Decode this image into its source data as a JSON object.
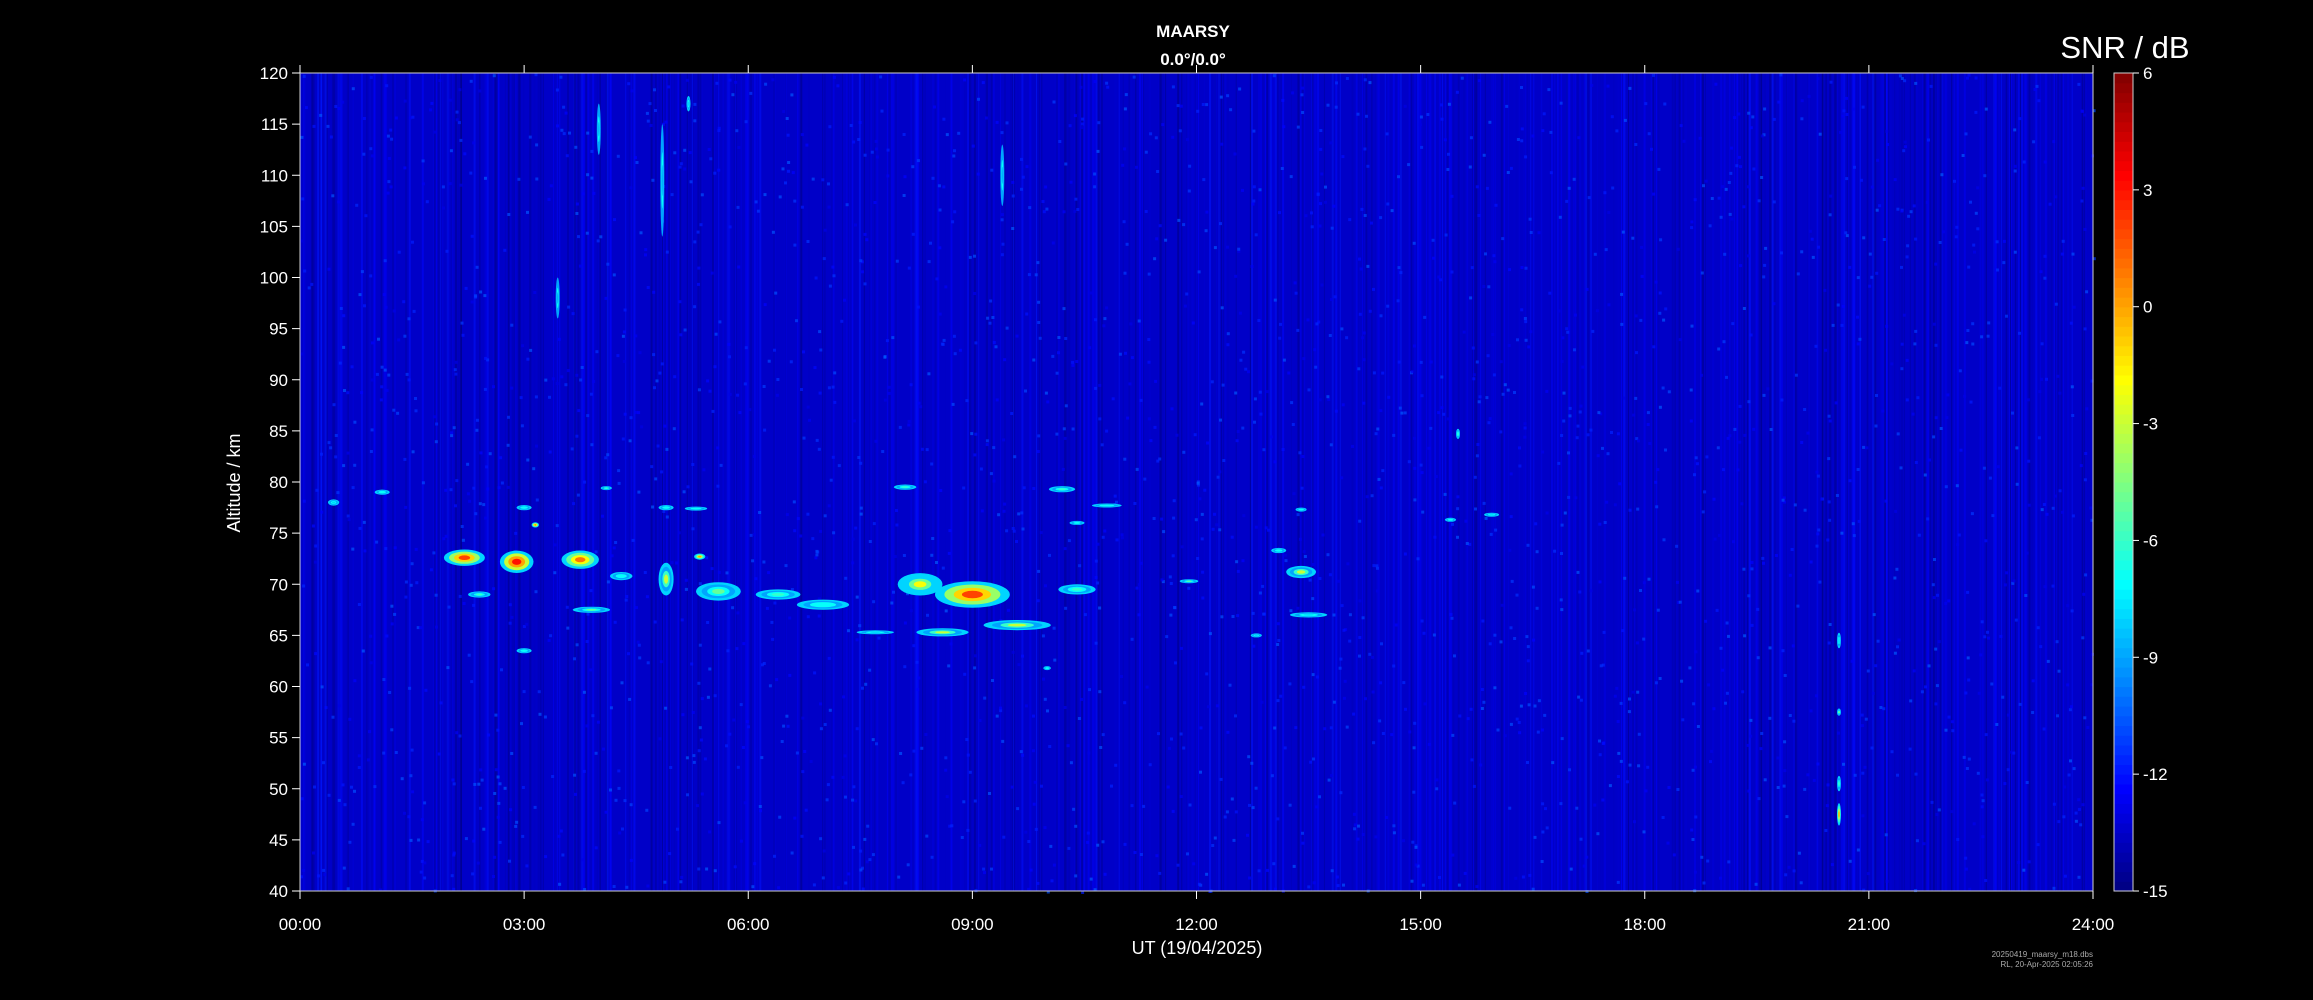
{
  "chart_data": {
    "type": "heatmap",
    "title": "MAARSY",
    "subtitle": "0.0°/0.0°",
    "xlabel": "UT (19/04/2025)",
    "ylabel": "Altitude / km",
    "x_ticks": [
      "00:00",
      "03:00",
      "06:00",
      "09:00",
      "12:00",
      "15:00",
      "18:00",
      "21:00",
      "24:00"
    ],
    "x_tick_hours": [
      0,
      3,
      6,
      9,
      12,
      15,
      18,
      21,
      24
    ],
    "xlim_hours": [
      0,
      24
    ],
    "y_ticks": [
      40,
      45,
      50,
      55,
      60,
      65,
      70,
      75,
      80,
      85,
      90,
      95,
      100,
      105,
      110,
      115,
      120
    ],
    "ylim": [
      40,
      120
    ],
    "colorbar": {
      "label": "SNR / dB",
      "range": [
        -15,
        6
      ],
      "ticks": [
        6,
        3,
        0,
        -3,
        -6,
        -9,
        -12,
        -15
      ],
      "colormap": "jet"
    },
    "background_snr": -13.5,
    "echoes": [
      {
        "t": 0.45,
        "h": 78,
        "dt": 0.15,
        "dh": 0.6,
        "snr": -8
      },
      {
        "t": 1.1,
        "h": 79,
        "dt": 0.2,
        "dh": 0.5,
        "snr": -7
      },
      {
        "t": 2.2,
        "h": 72.6,
        "dt": 0.55,
        "dh": 1.6,
        "snr": 2
      },
      {
        "t": 2.9,
        "h": 72.2,
        "dt": 0.45,
        "dh": 2.2,
        "snr": 3
      },
      {
        "t": 2.4,
        "h": 69,
        "dt": 0.3,
        "dh": 0.6,
        "snr": -6
      },
      {
        "t": 3.0,
        "h": 77.5,
        "dt": 0.2,
        "dh": 0.5,
        "snr": -7
      },
      {
        "t": 3.15,
        "h": 75.8,
        "dt": 0.1,
        "dh": 0.5,
        "snr": 1
      },
      {
        "t": 3.0,
        "h": 63.5,
        "dt": 0.2,
        "dh": 0.5,
        "snr": -7
      },
      {
        "t": 3.75,
        "h": 72.4,
        "dt": 0.5,
        "dh": 1.8,
        "snr": 1
      },
      {
        "t": 3.9,
        "h": 67.5,
        "dt": 0.5,
        "dh": 0.6,
        "snr": -5
      },
      {
        "t": 4.1,
        "h": 79.4,
        "dt": 0.15,
        "dh": 0.4,
        "snr": -6
      },
      {
        "t": 4.3,
        "h": 70.8,
        "dt": 0.3,
        "dh": 0.8,
        "snr": -7
      },
      {
        "t": 4.9,
        "h": 70.5,
        "dt": 0.2,
        "dh": 3.2,
        "snr": -3
      },
      {
        "t": 4.9,
        "h": 77.5,
        "dt": 0.2,
        "dh": 0.5,
        "snr": -7
      },
      {
        "t": 5.3,
        "h": 77.4,
        "dt": 0.3,
        "dh": 0.4,
        "snr": -7
      },
      {
        "t": 5.35,
        "h": 72.7,
        "dt": 0.15,
        "dh": 0.6,
        "snr": 0
      },
      {
        "t": 5.6,
        "h": 69.3,
        "dt": 0.6,
        "dh": 1.8,
        "snr": -5
      },
      {
        "t": 6.4,
        "h": 69.0,
        "dt": 0.6,
        "dh": 1.0,
        "snr": -6
      },
      {
        "t": 7.0,
        "h": 68.0,
        "dt": 0.7,
        "dh": 1.0,
        "snr": -7
      },
      {
        "t": 7.7,
        "h": 65.3,
        "dt": 0.5,
        "dh": 0.3,
        "snr": -8
      },
      {
        "t": 8.3,
        "h": 70.0,
        "dt": 0.6,
        "dh": 2.2,
        "snr": -2
      },
      {
        "t": 9.0,
        "h": 69.0,
        "dt": 1.0,
        "dh": 2.6,
        "snr": 2
      },
      {
        "t": 8.6,
        "h": 65.3,
        "dt": 0.7,
        "dh": 0.8,
        "snr": -3
      },
      {
        "t": 9.6,
        "h": 66.0,
        "dt": 0.9,
        "dh": 1.0,
        "snr": -3
      },
      {
        "t": 10.4,
        "h": 69.5,
        "dt": 0.5,
        "dh": 1.0,
        "snr": -6
      },
      {
        "t": 8.1,
        "h": 79.5,
        "dt": 0.3,
        "dh": 0.5,
        "snr": -6
      },
      {
        "t": 10.2,
        "h": 79.3,
        "dt": 0.35,
        "dh": 0.6,
        "snr": -6
      },
      {
        "t": 10.8,
        "h": 77.7,
        "dt": 0.4,
        "dh": 0.4,
        "snr": -7
      },
      {
        "t": 10.4,
        "h": 76,
        "dt": 0.2,
        "dh": 0.4,
        "snr": -7
      },
      {
        "t": 10.0,
        "h": 61.8,
        "dt": 0.1,
        "dh": 0.4,
        "snr": -7
      },
      {
        "t": 11.9,
        "h": 70.3,
        "dt": 0.25,
        "dh": 0.4,
        "snr": -5
      },
      {
        "t": 13.4,
        "h": 71.2,
        "dt": 0.4,
        "dh": 1.2,
        "snr": -3
      },
      {
        "t": 13.1,
        "h": 73.3,
        "dt": 0.2,
        "dh": 0.5,
        "snr": -7
      },
      {
        "t": 13.4,
        "h": 77.3,
        "dt": 0.15,
        "dh": 0.4,
        "snr": -7
      },
      {
        "t": 13.5,
        "h": 67.0,
        "dt": 0.5,
        "dh": 0.5,
        "snr": -8
      },
      {
        "t": 12.8,
        "h": 65.0,
        "dt": 0.15,
        "dh": 0.4,
        "snr": -8
      },
      {
        "t": 15.4,
        "h": 76.3,
        "dt": 0.15,
        "dh": 0.4,
        "snr": -7
      },
      {
        "t": 15.95,
        "h": 76.8,
        "dt": 0.2,
        "dh": 0.4,
        "snr": -8
      },
      {
        "t": 15.5,
        "h": 84.7,
        "dt": 0.04,
        "dh": 1.0,
        "snr": -6
      },
      {
        "t": 20.6,
        "h": 47.5,
        "dt": 0.03,
        "dh": 2.2,
        "snr": 0
      },
      {
        "t": 20.6,
        "h": 50.5,
        "dt": 0.03,
        "dh": 1.5,
        "snr": -6
      },
      {
        "t": 20.6,
        "h": 57.5,
        "dt": 0.03,
        "dh": 0.7,
        "snr": -4
      },
      {
        "t": 20.6,
        "h": 64.5,
        "dt": 0.03,
        "dh": 1.5,
        "snr": -8
      },
      {
        "t": 4.85,
        "h": 109.5,
        "dt": 0.04,
        "dh": 11,
        "snr": -9
      },
      {
        "t": 5.2,
        "h": 117,
        "dt": 0.04,
        "dh": 1.5,
        "snr": -8
      },
      {
        "t": 3.45,
        "h": 98.0,
        "dt": 0.03,
        "dh": 4,
        "snr": -9
      },
      {
        "t": 4.0,
        "h": 114.5,
        "dt": 0.03,
        "dh": 5,
        "snr": -9
      },
      {
        "t": 9.4,
        "h": 110,
        "dt": 0.03,
        "dh": 6,
        "snr": -9
      }
    ],
    "footnote": [
      "20250419_maarsy_m18.dbs",
      "RL, 20-Apr-2025 02:05:26"
    ]
  }
}
